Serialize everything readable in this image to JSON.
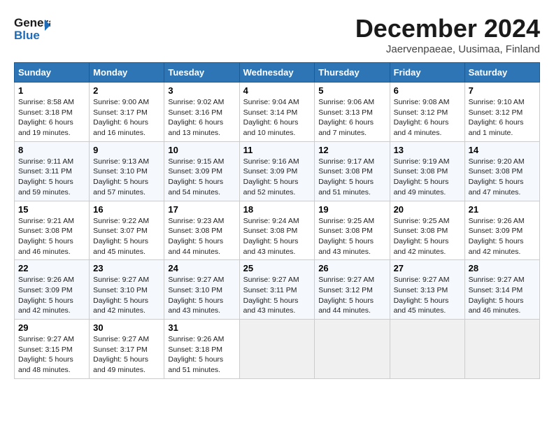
{
  "header": {
    "logo_line1": "General",
    "logo_line2": "Blue",
    "title": "December 2024",
    "subtitle": "Jaervenpaeae, Uusimaa, Finland"
  },
  "columns": [
    "Sunday",
    "Monday",
    "Tuesday",
    "Wednesday",
    "Thursday",
    "Friday",
    "Saturday"
  ],
  "weeks": [
    [
      {
        "day": "1",
        "sunrise": "Sunrise: 8:58 AM",
        "sunset": "Sunset: 3:18 PM",
        "daylight": "Daylight: 6 hours and 19 minutes."
      },
      {
        "day": "2",
        "sunrise": "Sunrise: 9:00 AM",
        "sunset": "Sunset: 3:17 PM",
        "daylight": "Daylight: 6 hours and 16 minutes."
      },
      {
        "day": "3",
        "sunrise": "Sunrise: 9:02 AM",
        "sunset": "Sunset: 3:16 PM",
        "daylight": "Daylight: 6 hours and 13 minutes."
      },
      {
        "day": "4",
        "sunrise": "Sunrise: 9:04 AM",
        "sunset": "Sunset: 3:14 PM",
        "daylight": "Daylight: 6 hours and 10 minutes."
      },
      {
        "day": "5",
        "sunrise": "Sunrise: 9:06 AM",
        "sunset": "Sunset: 3:13 PM",
        "daylight": "Daylight: 6 hours and 7 minutes."
      },
      {
        "day": "6",
        "sunrise": "Sunrise: 9:08 AM",
        "sunset": "Sunset: 3:12 PM",
        "daylight": "Daylight: 6 hours and 4 minutes."
      },
      {
        "day": "7",
        "sunrise": "Sunrise: 9:10 AM",
        "sunset": "Sunset: 3:12 PM",
        "daylight": "Daylight: 6 hours and 1 minute."
      }
    ],
    [
      {
        "day": "8",
        "sunrise": "Sunrise: 9:11 AM",
        "sunset": "Sunset: 3:11 PM",
        "daylight": "Daylight: 5 hours and 59 minutes."
      },
      {
        "day": "9",
        "sunrise": "Sunrise: 9:13 AM",
        "sunset": "Sunset: 3:10 PM",
        "daylight": "Daylight: 5 hours and 57 minutes."
      },
      {
        "day": "10",
        "sunrise": "Sunrise: 9:15 AM",
        "sunset": "Sunset: 3:09 PM",
        "daylight": "Daylight: 5 hours and 54 minutes."
      },
      {
        "day": "11",
        "sunrise": "Sunrise: 9:16 AM",
        "sunset": "Sunset: 3:09 PM",
        "daylight": "Daylight: 5 hours and 52 minutes."
      },
      {
        "day": "12",
        "sunrise": "Sunrise: 9:17 AM",
        "sunset": "Sunset: 3:08 PM",
        "daylight": "Daylight: 5 hours and 51 minutes."
      },
      {
        "day": "13",
        "sunrise": "Sunrise: 9:19 AM",
        "sunset": "Sunset: 3:08 PM",
        "daylight": "Daylight: 5 hours and 49 minutes."
      },
      {
        "day": "14",
        "sunrise": "Sunrise: 9:20 AM",
        "sunset": "Sunset: 3:08 PM",
        "daylight": "Daylight: 5 hours and 47 minutes."
      }
    ],
    [
      {
        "day": "15",
        "sunrise": "Sunrise: 9:21 AM",
        "sunset": "Sunset: 3:08 PM",
        "daylight": "Daylight: 5 hours and 46 minutes."
      },
      {
        "day": "16",
        "sunrise": "Sunrise: 9:22 AM",
        "sunset": "Sunset: 3:07 PM",
        "daylight": "Daylight: 5 hours and 45 minutes."
      },
      {
        "day": "17",
        "sunrise": "Sunrise: 9:23 AM",
        "sunset": "Sunset: 3:08 PM",
        "daylight": "Daylight: 5 hours and 44 minutes."
      },
      {
        "day": "18",
        "sunrise": "Sunrise: 9:24 AM",
        "sunset": "Sunset: 3:08 PM",
        "daylight": "Daylight: 5 hours and 43 minutes."
      },
      {
        "day": "19",
        "sunrise": "Sunrise: 9:25 AM",
        "sunset": "Sunset: 3:08 PM",
        "daylight": "Daylight: 5 hours and 43 minutes."
      },
      {
        "day": "20",
        "sunrise": "Sunrise: 9:25 AM",
        "sunset": "Sunset: 3:08 PM",
        "daylight": "Daylight: 5 hours and 42 minutes."
      },
      {
        "day": "21",
        "sunrise": "Sunrise: 9:26 AM",
        "sunset": "Sunset: 3:09 PM",
        "daylight": "Daylight: 5 hours and 42 minutes."
      }
    ],
    [
      {
        "day": "22",
        "sunrise": "Sunrise: 9:26 AM",
        "sunset": "Sunset: 3:09 PM",
        "daylight": "Daylight: 5 hours and 42 minutes."
      },
      {
        "day": "23",
        "sunrise": "Sunrise: 9:27 AM",
        "sunset": "Sunset: 3:10 PM",
        "daylight": "Daylight: 5 hours and 42 minutes."
      },
      {
        "day": "24",
        "sunrise": "Sunrise: 9:27 AM",
        "sunset": "Sunset: 3:10 PM",
        "daylight": "Daylight: 5 hours and 43 minutes."
      },
      {
        "day": "25",
        "sunrise": "Sunrise: 9:27 AM",
        "sunset": "Sunset: 3:11 PM",
        "daylight": "Daylight: 5 hours and 43 minutes."
      },
      {
        "day": "26",
        "sunrise": "Sunrise: 9:27 AM",
        "sunset": "Sunset: 3:12 PM",
        "daylight": "Daylight: 5 hours and 44 minutes."
      },
      {
        "day": "27",
        "sunrise": "Sunrise: 9:27 AM",
        "sunset": "Sunset: 3:13 PM",
        "daylight": "Daylight: 5 hours and 45 minutes."
      },
      {
        "day": "28",
        "sunrise": "Sunrise: 9:27 AM",
        "sunset": "Sunset: 3:14 PM",
        "daylight": "Daylight: 5 hours and 46 minutes."
      }
    ],
    [
      {
        "day": "29",
        "sunrise": "Sunrise: 9:27 AM",
        "sunset": "Sunset: 3:15 PM",
        "daylight": "Daylight: 5 hours and 48 minutes."
      },
      {
        "day": "30",
        "sunrise": "Sunrise: 9:27 AM",
        "sunset": "Sunset: 3:17 PM",
        "daylight": "Daylight: 5 hours and 49 minutes."
      },
      {
        "day": "31",
        "sunrise": "Sunrise: 9:26 AM",
        "sunset": "Sunset: 3:18 PM",
        "daylight": "Daylight: 5 hours and 51 minutes."
      },
      null,
      null,
      null,
      null
    ]
  ]
}
